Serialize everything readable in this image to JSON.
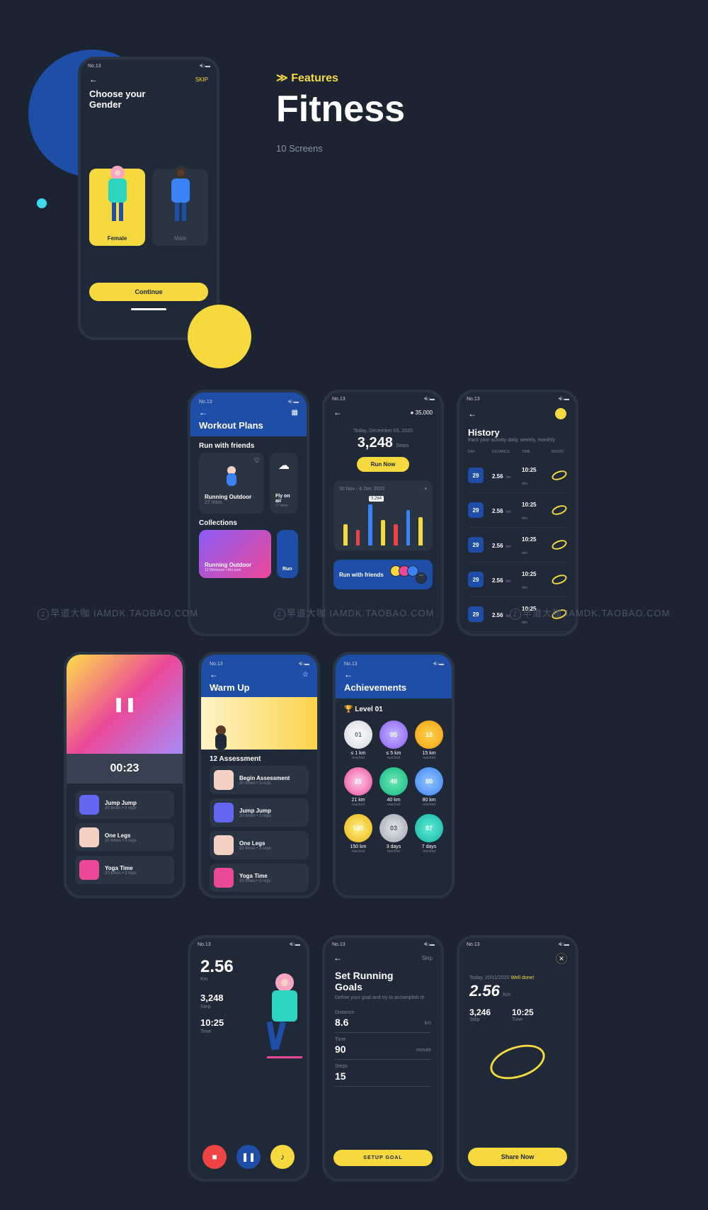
{
  "hero": {
    "features": "Features",
    "title": "Fitness",
    "sub": "10 Screens"
  },
  "status": {
    "carrier": "No.13",
    "signal": "•ıl ⌂ ▬"
  },
  "s1": {
    "skip": "SKIP",
    "title": "Choose your\nGender",
    "female": "Female",
    "male": "Male",
    "continue": "Continue"
  },
  "s2": {
    "title": "Workout Plans",
    "sec1": "Run with friends",
    "c1": "Running Outdoor",
    "c1s": "27 mins",
    "c2": "Fly on air",
    "c2s": "27 mins",
    "sec2": "Collections",
    "c3": "Running Outdoor",
    "c3s": "12 Workouts • All Level",
    "c4": "Run"
  },
  "s3": {
    "coins": "35,000",
    "date": "Today, December 03, 2020",
    "steps": "3,248",
    "steps_unit": "Steps",
    "run": "Run Now",
    "range": "30 Nov - 6 Dec 2020",
    "peak": "3,284",
    "friends": "Run with friends"
  },
  "s4": {
    "title": "History",
    "sub": "track your activity daily, weekly, monthly",
    "h_day": "DAY",
    "h_dist": "DISTANCE",
    "h_time": "TIME",
    "h_route": "ROUTE",
    "day": "29",
    "dist": "2.56",
    "dist_u": "km",
    "time": "10:25",
    "time_u": "min"
  },
  "s5": {
    "timer": "00:23",
    "e1": "Jump Jump",
    "e2": "One Legs",
    "e3": "Yoga Time",
    "reps": "20 times • 3 reps"
  },
  "s6": {
    "title": "Warm Up",
    "sec": "12 Assessment",
    "e0": "Begin Assessment",
    "e1": "Jump Jump",
    "e2": "One Legs",
    "e3": "Yoga Time",
    "reps": "20 times • 3 reps",
    "reached": "reached"
  },
  "s7": {
    "title": "Achievements",
    "level": "Level 01",
    "b1": "01",
    "b1l": "≤ 1 km",
    "b2": "05",
    "b2l": "≤ 5 km",
    "b3": "15",
    "b3l": "15 km",
    "b4": "21",
    "b4l": "21 km",
    "b5": "40",
    "b5l": "40 km",
    "b6": "80",
    "b6l": "80 km",
    "b7": "150",
    "b7l": "150 km",
    "b8": "03",
    "b8l": "3 days",
    "b9": "07",
    "b9l": "7 days",
    "reached": "reached"
  },
  "s8": {
    "km": "2.56",
    "km_u": "Km",
    "steps": "3,248",
    "steps_u": "Step",
    "time": "10:25",
    "time_u": "Time"
  },
  "s9": {
    "skip": "Skip",
    "title": "Set Running\nGoals",
    "sub": "Define your goal and try to accomplish it!",
    "dist_l": "Distance",
    "dist_v": "8.6",
    "dist_u": "km",
    "time_l": "Time",
    "time_v": "90",
    "time_u": "minute",
    "steps_l": "Steps",
    "steps_v": "15",
    "btn": "SETUP GOAL"
  },
  "s10": {
    "date": "Today, 20/11/2020",
    "well": "Well done!",
    "km": "2.56",
    "km_u": "Km",
    "steps": "3,246",
    "steps_u": "Step",
    "time": "10:25",
    "time_u": "Time",
    "btn": "Share Now"
  },
  "wm": {
    "t1": "早道大咖",
    "t2": "IAMDK.TAOBAO.COM"
  }
}
